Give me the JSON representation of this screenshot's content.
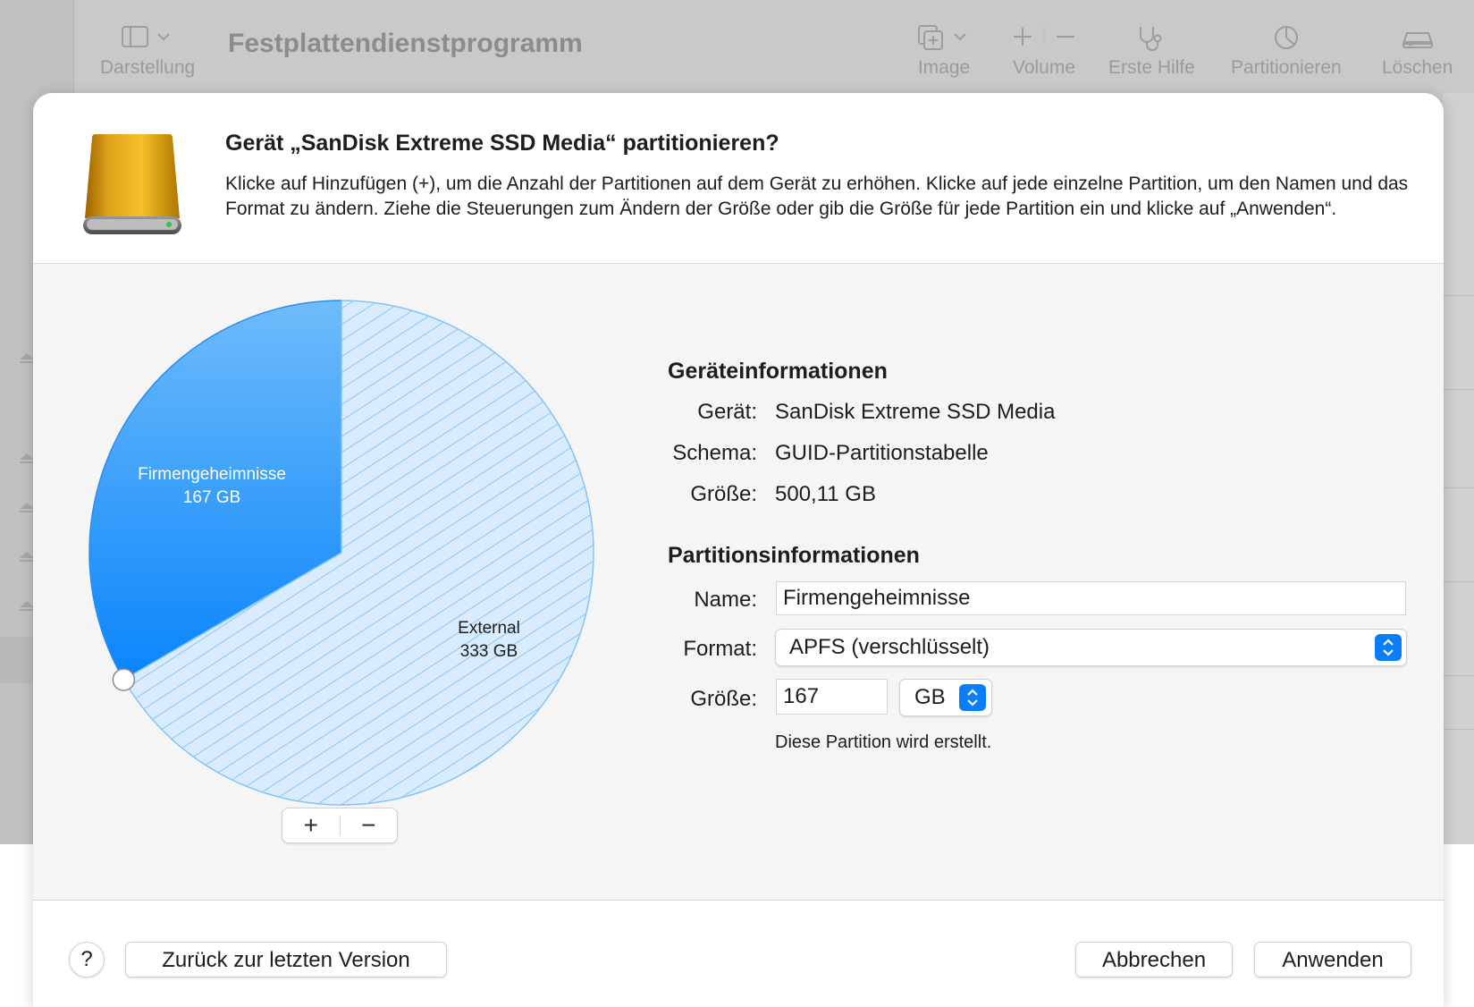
{
  "window": {
    "title": "Festplattendienstprogramm",
    "toolbar": {
      "view_label": "Darstellung",
      "image_label": "Image",
      "volume_label": "Volume",
      "first_aid_label": "Erste Hilfe",
      "partition_label": "Partitionieren",
      "erase_label": "Löschen"
    }
  },
  "dialog": {
    "title": "Gerät „SanDisk Extreme SSD Media“ partitionieren?",
    "description": "Klicke auf Hinzufügen (+), um die Anzahl der Partitionen auf dem Gerät zu erhöhen. Klicke auf jede einzelne Partition, um den Namen und das Format zu ändern. Ziehe die Steuerungen zum Ändern der Größe oder gib die Größe für jede Partition ein und klicke auf „Anwenden“.",
    "icon": "external-drive-icon"
  },
  "partition_chart": {
    "partitions": [
      {
        "name": "Firmengeheimnisse",
        "size_label": "167 GB",
        "size_gb": 167,
        "color": "#1a8dfc",
        "selected": true
      },
      {
        "name": "External",
        "size_label": "333 GB",
        "size_gb": 333,
        "color": "#d8ecfd",
        "pattern": "hatched"
      }
    ],
    "add_label": "+",
    "remove_label": "−"
  },
  "device_info": {
    "heading": "Geräteinformationen",
    "device_label": "Gerät:",
    "device_value": "SanDisk Extreme SSD Media",
    "scheme_label": "Schema:",
    "scheme_value": "GUID-Partitionstabelle",
    "size_label": "Größe:",
    "size_value": "500,11 GB"
  },
  "partition_info": {
    "heading": "Partitionsinformationen",
    "name_label": "Name:",
    "name_value": "Firmengeheimnisse",
    "format_label": "Format:",
    "format_value": "APFS (verschlüsselt)",
    "size_label": "Größe:",
    "size_value": "167",
    "unit_value": "GB",
    "note": "Diese Partition wird erstellt."
  },
  "footer": {
    "help_label": "?",
    "revert_label": "Zurück zur letzten Version",
    "cancel_label": "Abbrechen",
    "apply_label": "Anwenden"
  },
  "colors": {
    "accent": "#0a7dfc",
    "selected_partition": "#1a8dfc",
    "free_partition": "#d8ecfd"
  }
}
